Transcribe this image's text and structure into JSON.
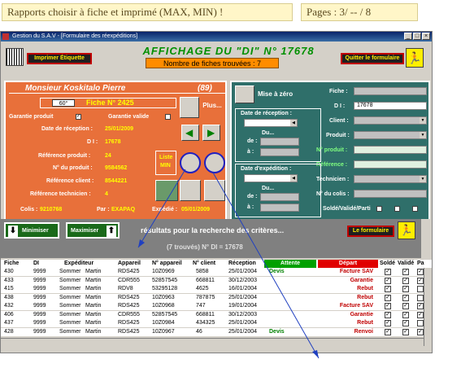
{
  "banner_left": "Rapports choisir à fiche et imprimé (MAX, MIN) !",
  "banner_right": "Pages : 3/ -- / 8",
  "window": {
    "title": "Gestion du S.A.V - [Formulaire des réexpéditions]",
    "btn_min": "_",
    "btn_max": "□",
    "btn_close": "×"
  },
  "header": {
    "print_label": "Imprimer Étiquette",
    "title": "AFFICHAGE DU \"DI\" N° 17678",
    "count": "Nombre de fiches trouvées : 7",
    "quit_label": "Quitter le formulaire"
  },
  "left": {
    "name": "Monsieur   Koskitalo   Pierre",
    "age": "(89)",
    "size": "60°",
    "fiche": "Fiche N° 2425",
    "garantie_produit": "Garantie produit",
    "garantie_valide": "Garantie valide",
    "date_reception_label": "Date de réception :",
    "date_reception": "25/01/2009",
    "di_label": "D I :",
    "di": "17678",
    "ref_produit_label": "Référence produit :",
    "ref_produit": "24",
    "no_produit_label": "N° du produit :",
    "no_produit": "9584562",
    "ref_client_label": "Référence client :",
    "ref_client": "8544221",
    "ref_tech_label": "Référence technicien :",
    "ref_tech": "4",
    "colis_label": "Colis :",
    "colis": "9210768",
    "par_label": "Par :",
    "par": "EXAPAQ",
    "expedie_label": "Expédié :",
    "expedie": "05/01/2009",
    "plus_label": "Plus...",
    "liste_label": "Liste",
    "min_label": "MIN"
  },
  "right": {
    "mise_a_zero": "Mise à zéro",
    "fiche_label": "Fiche :",
    "di_label": "D I :",
    "di": "17678",
    "client_label": "Client :",
    "produit_label": "Produit :",
    "no_produit_label": "N° produit :",
    "reference_label": "Référence :",
    "technicien_label": "Technicien :",
    "no_colis_label": "N° du colis :",
    "solde_label": "Soldé/Validé/Parti",
    "date_rec_label": "Date de réception :",
    "du": "Du...",
    "de": "de :",
    "a": "à :",
    "date_exp_label": "Date d'expédition :"
  },
  "mid": {
    "minimiser": "Minimiser",
    "maximiser": "Maximiser",
    "resultats": "résultats pour la recherche des critères...",
    "trouves": "(7 trouvés)  N° DI = 17678",
    "formulaire": "Le formulaire"
  },
  "table": {
    "headers": [
      "Fiche",
      "DI",
      "Expéditeur",
      "Appareil",
      "N° appareil",
      "N° client",
      "Réception",
      "Attente",
      "Départ",
      "Soldé",
      "Validé",
      "Pa"
    ],
    "rows": [
      {
        "fiche": "430",
        "di": "9999",
        "nom": "Sommer",
        "prenom": "Martin",
        "appareil": "RDS425",
        "napp": "10Z0969",
        "nclient": "5858",
        "reception": "25/01/2004",
        "attente": "Devis",
        "depart": "Facture SAV",
        "solde": "✓",
        "valide": "✓",
        "pa": "✓"
      },
      {
        "fiche": "433",
        "di": "9999",
        "nom": "Sommer",
        "prenom": "Martin",
        "appareil": "CDR555",
        "napp": "52857545",
        "nclient": "668811",
        "reception": "30/12/2003",
        "attente": "",
        "depart": "Garantie",
        "solde": "✓",
        "valide": "✓",
        "pa": "✓"
      },
      {
        "fiche": "415",
        "di": "9999",
        "nom": "Sommer",
        "prenom": "Martin",
        "appareil": "RDV8",
        "napp": "53295128",
        "nclient": "4625",
        "reception": "16/01/2004",
        "attente": "",
        "depart": "Rebut",
        "solde": "✓",
        "valide": "✓",
        "pa": ""
      },
      {
        "fiche": "438",
        "di": "9999",
        "nom": "Sommer",
        "prenom": "Martin",
        "appareil": "RDS425",
        "napp": "10Z0963",
        "nclient": "787875",
        "reception": "25/01/2004",
        "attente": "",
        "depart": "Rebut",
        "solde": "✓",
        "valide": "✓",
        "pa": ""
      },
      {
        "fiche": "432",
        "di": "9999",
        "nom": "Sommer",
        "prenom": "Martin",
        "appareil": "RDS425",
        "napp": "10Z0968",
        "nclient": "747",
        "reception": "19/01/2004",
        "attente": "",
        "depart": "Facture SAV",
        "solde": "✓",
        "valide": "✓",
        "pa": "✓"
      },
      {
        "fiche": "406",
        "di": "9999",
        "nom": "Sommer",
        "prenom": "Martin",
        "appareil": "CDR555",
        "napp": "52857545",
        "nclient": "668811",
        "reception": "30/12/2003",
        "attente": "",
        "depart": "Garantie",
        "solde": "✓",
        "valide": "✓",
        "pa": "✓"
      },
      {
        "fiche": "437",
        "di": "9999",
        "nom": "Sommer",
        "prenom": "Martin",
        "appareil": "RDS425",
        "napp": "10Z0984",
        "nclient": "434325",
        "reception": "25/01/2004",
        "attente": "",
        "depart": "Rebut",
        "solde": "✓",
        "valide": "✓",
        "pa": ""
      },
      {
        "fiche": "428",
        "di": "9999",
        "nom": "Sommer",
        "prenom": "Martin",
        "appareil": "RDS425",
        "napp": "10Z0967",
        "nclient": "46",
        "reception": "25/01/2004",
        "attente": "Devis",
        "depart": "Renvoi",
        "solde": "✓",
        "valide": "✓",
        "pa": "✓"
      }
    ]
  }
}
